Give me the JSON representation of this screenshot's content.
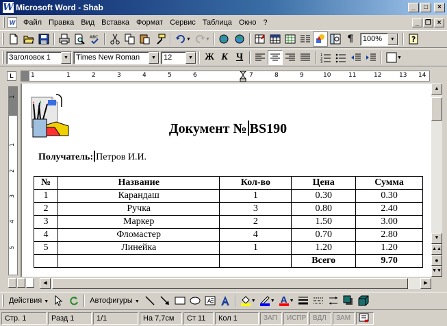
{
  "window": {
    "title": "Microsoft Word - Shab",
    "app_icon": "W"
  },
  "menu": {
    "items": [
      "Файл",
      "Правка",
      "Вид",
      "Вставка",
      "Формат",
      "Сервис",
      "Таблица",
      "Окно",
      "?"
    ]
  },
  "standard_toolbar": {
    "zoom": "100%"
  },
  "format_toolbar": {
    "style": "Заголовок 1",
    "font": "Times New Roman",
    "size": "12",
    "bold_label": "Ж",
    "italic_label": "К",
    "underline_label": "Ч"
  },
  "ruler": {
    "tab_button": "L",
    "numbers": [
      "1",
      "1",
      "2",
      "3",
      "4",
      "5",
      "6",
      "7",
      "8",
      "9",
      "10",
      "11",
      "12",
      "13",
      "14",
      "15"
    ]
  },
  "vruler": {
    "numbers": [
      "1",
      "1",
      "2",
      "3",
      "4",
      "5"
    ]
  },
  "document": {
    "title_prefix": "Документ №",
    "title_number": "BS190",
    "recipient_label": "Получатель:",
    "recipient_value": "Петров И.И.",
    "table": {
      "headers": [
        "№",
        "Название",
        "Кол-во",
        "Цена",
        "Сумма"
      ],
      "rows": [
        [
          "1",
          "Карандаш",
          "1",
          "0.30",
          "0.30"
        ],
        [
          "2",
          "Ручка",
          "3",
          "0.80",
          "2.40"
        ],
        [
          "3",
          "Маркер",
          "2",
          "1.50",
          "3.00"
        ],
        [
          "4",
          "Фломастер",
          "4",
          "0.70",
          "2.80"
        ],
        [
          "5",
          "Линейка",
          "1",
          "1.20",
          "1.20"
        ]
      ],
      "total_label": "Всего",
      "total_value": "9.70"
    }
  },
  "drawing_toolbar": {
    "actions_label": "Действия",
    "autoshapes_label": "Автофигуры"
  },
  "status_bar": {
    "page": "Стр. 1",
    "section": "Разд 1",
    "pages": "1/1",
    "position": "На 7,7см",
    "line": "Ст 11",
    "column": "Кол 1",
    "rec": "ЗАП",
    "trk": "ИСПР",
    "ext": "ВДЛ",
    "ovr": "ЗАМ"
  },
  "colors": {
    "titlebar_start": "#0a246a",
    "titlebar_end": "#a6caf0",
    "chrome": "#d4d0c8",
    "highlight_yellow": "#ffff00",
    "font_color_red": "#ff0000",
    "line_color_blue": "#0000ff"
  }
}
